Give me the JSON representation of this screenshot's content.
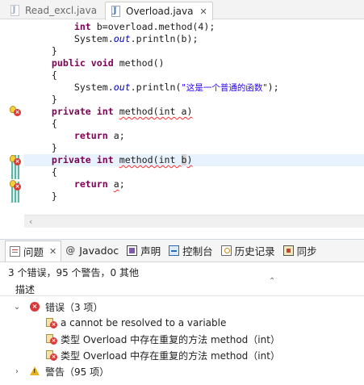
{
  "editor": {
    "tabs": [
      {
        "label": "Read_excl.java",
        "active": false
      },
      {
        "label": "Overload.java",
        "active": true
      }
    ],
    "close_glyph": "✕",
    "lines": [
      {
        "indent": "        ",
        "parts": [
          [
            "kw",
            "int"
          ],
          [
            "t",
            " b=overload.method(4);"
          ]
        ]
      },
      {
        "indent": "        ",
        "parts": [
          [
            "t",
            "System."
          ],
          [
            "em",
            "out"
          ],
          [
            "t",
            ".println(b);"
          ]
        ]
      },
      {
        "indent": "    ",
        "parts": [
          [
            "t",
            "}"
          ]
        ]
      },
      {
        "indent": "    ",
        "parts": [
          [
            "kw",
            "public"
          ],
          [
            "t",
            " "
          ],
          [
            "kw",
            "void"
          ],
          [
            "t",
            " method()"
          ]
        ]
      },
      {
        "indent": "    ",
        "parts": [
          [
            "t",
            "{"
          ]
        ]
      },
      {
        "indent": "        ",
        "parts": [
          [
            "t",
            "System."
          ],
          [
            "em",
            "out"
          ],
          [
            "t",
            ".println("
          ],
          [
            "str",
            "\"这是一个普通的函数\""
          ],
          [
            "t",
            ");"
          ]
        ]
      },
      {
        "indent": "    ",
        "parts": [
          [
            "t",
            "}"
          ]
        ]
      },
      {
        "indent": "    ",
        "parts": [
          [
            "kw",
            "private"
          ],
          [
            "t",
            " "
          ],
          [
            "kw",
            "int"
          ],
          [
            "t",
            " "
          ],
          [
            "err",
            "method(int a)"
          ]
        ]
      },
      {
        "indent": "    ",
        "parts": [
          [
            "t",
            "{"
          ]
        ]
      },
      {
        "indent": "        ",
        "parts": [
          [
            "kw",
            "return"
          ],
          [
            "t",
            " a;"
          ]
        ]
      },
      {
        "indent": "    ",
        "parts": [
          [
            "t",
            "}"
          ]
        ]
      },
      {
        "indent": "    ",
        "parts": [
          [
            "kw",
            "private"
          ],
          [
            "t",
            " "
          ],
          [
            "kw",
            "int"
          ],
          [
            "t",
            " "
          ],
          [
            "err",
            "method(int "
          ],
          [
            "occ",
            "b"
          ],
          [
            "err",
            ")"
          ]
        ],
        "highlight": true
      },
      {
        "indent": "    ",
        "parts": [
          [
            "t",
            "{"
          ]
        ]
      },
      {
        "indent": "        ",
        "parts": [
          [
            "kw",
            "return"
          ],
          [
            "t",
            " "
          ],
          [
            "err",
            "a"
          ],
          [
            "t",
            ";"
          ]
        ]
      },
      {
        "indent": "    ",
        "parts": [
          [
            "t",
            "}"
          ]
        ]
      }
    ]
  },
  "problems_view": {
    "tabs": [
      {
        "label": "问题",
        "icon": "problems-icon",
        "active": true,
        "close": "✕"
      },
      {
        "label": "Javadoc",
        "icon": "at-icon"
      },
      {
        "label": "声明",
        "icon": "declaration-icon"
      },
      {
        "label": "控制台",
        "icon": "console-icon"
      },
      {
        "label": "历史记录",
        "icon": "history-icon"
      },
      {
        "label": "同步",
        "icon": "sync-icon"
      }
    ],
    "summary": "3 个错误，95 个警告，0 其他",
    "column_header": "描述",
    "errors_group": "错误（3 项）",
    "errors": [
      "a cannot be resolved to a variable",
      "类型 Overload 中存在重复的方法 method（int）",
      "类型 Overload 中存在重复的方法 method（int）"
    ],
    "warnings_group": "警告（95 项）"
  }
}
